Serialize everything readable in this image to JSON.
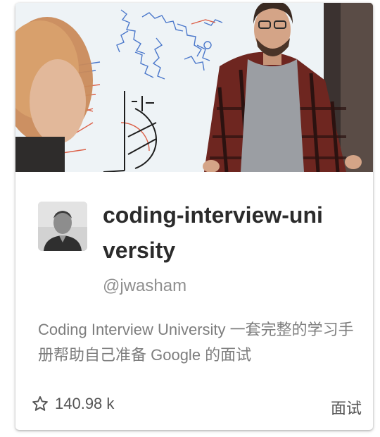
{
  "repo": {
    "name": "coding-interview-university",
    "owner": "@jwasham",
    "description": "Coding Interview University 一套完整的学习手册帮助自己准备 Google 的面试",
    "stars": "140.98 k",
    "topic": "面试"
  },
  "icons": {
    "stars": "star-outline-icon"
  },
  "colors": {
    "title": "#2b2b2b",
    "owner": "#8f8f8f",
    "description": "#7d7d7d",
    "footer_text": "#555555"
  }
}
